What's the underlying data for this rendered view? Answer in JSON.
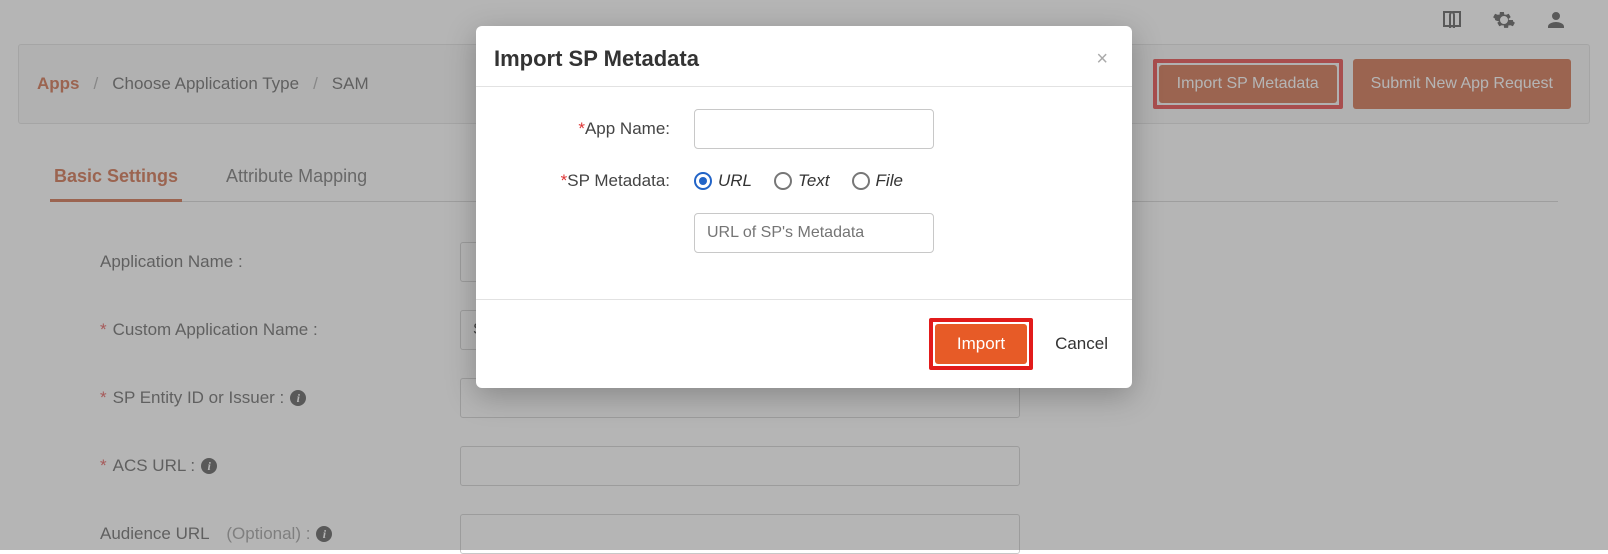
{
  "topbar": {
    "icons": [
      "book-icon",
      "gear-icon",
      "user-icon"
    ]
  },
  "breadcrumb": {
    "items": [
      "Apps",
      "Choose Application Type",
      "SAM"
    ]
  },
  "header_buttons": {
    "import_sp": "Import SP Metadata",
    "submit_request": "Submit New App Request"
  },
  "tabs": {
    "basic": "Basic Settings",
    "attribute": "Attribute Mapping"
  },
  "form": {
    "app_name_label": "Application Name :",
    "custom_app_label": "Custom Application Name :",
    "custom_app_value": "Salesforce",
    "sp_entity_label": "SP Entity ID or Issuer :",
    "acs_url_label": "ACS URL :",
    "audience_url_label": "Audience URL",
    "audience_url_optional": "(Optional) :"
  },
  "modal": {
    "title": "Import SP Metadata",
    "app_name_label": "App Name:",
    "sp_metadata_label": "SP Metadata:",
    "radio_url": "URL",
    "radio_text": "Text",
    "radio_file": "File",
    "url_placeholder": "URL of SP's Metadata",
    "import_btn": "Import",
    "cancel_btn": "Cancel"
  }
}
